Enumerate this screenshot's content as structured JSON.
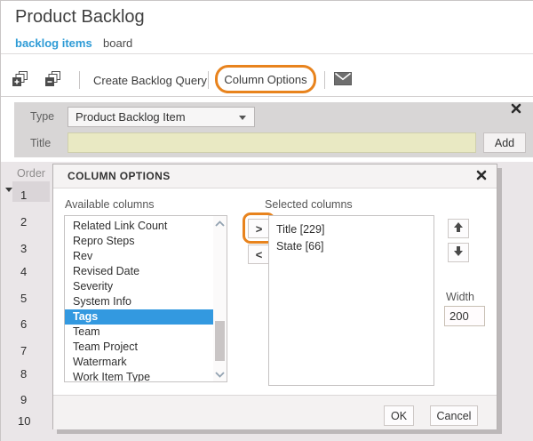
{
  "header": {
    "title": "Product Backlog"
  },
  "tabs": [
    {
      "label": "backlog items",
      "active": true
    },
    {
      "label": "board",
      "active": false
    }
  ],
  "toolbar": {
    "create_query_label": "Create Backlog Query",
    "column_options_label": "Column Options"
  },
  "add_panel": {
    "type_label": "Type",
    "type_value": "Product Backlog Item",
    "title_label": "Title",
    "title_value": "",
    "add_label": "Add"
  },
  "grid": {
    "order_header": "Order",
    "order_rows": [
      "1",
      "2",
      "3",
      "4",
      "5",
      "6",
      "7",
      "8",
      "9",
      "10"
    ]
  },
  "dialog": {
    "title": "COLUMN OPTIONS",
    "available_label": "Available columns",
    "available_items": [
      {
        "label": "Related Link Count",
        "selected": false
      },
      {
        "label": "Repro Steps",
        "selected": false
      },
      {
        "label": "Rev",
        "selected": false
      },
      {
        "label": "Revised Date",
        "selected": false
      },
      {
        "label": "Severity",
        "selected": false
      },
      {
        "label": "System Info",
        "selected": false
      },
      {
        "label": "Tags",
        "selected": true
      },
      {
        "label": "Team",
        "selected": false
      },
      {
        "label": "Team Project",
        "selected": false
      },
      {
        "label": "Watermark",
        "selected": false
      },
      {
        "label": "Work Item Type",
        "selected": false
      }
    ],
    "selected_label": "Selected columns",
    "selected_items": [
      "Title [229]",
      "State [66]"
    ],
    "move_right_label": ">",
    "move_left_label": "<",
    "width_label": "Width",
    "width_value": "200",
    "ok_label": "OK",
    "cancel_label": "Cancel"
  },
  "icons": {
    "expand_all": "expand-all-icon",
    "collapse_all": "collapse-all-icon",
    "email": "envelope-icon",
    "close": "x-mark-icon",
    "dropdown": "caret-down-icon",
    "move_up": "arrow-up-icon",
    "move_down": "arrow-down-icon",
    "scroll_up": "chevron-up-icon",
    "scroll_down": "chevron-down-icon",
    "row_expand": "triangle-down-icon"
  },
  "colors": {
    "accent_blue": "#2e9bd6",
    "selection_blue": "#3399e0",
    "annotation_orange": "#e8831d",
    "input_yellow": "#e9e9c3"
  }
}
